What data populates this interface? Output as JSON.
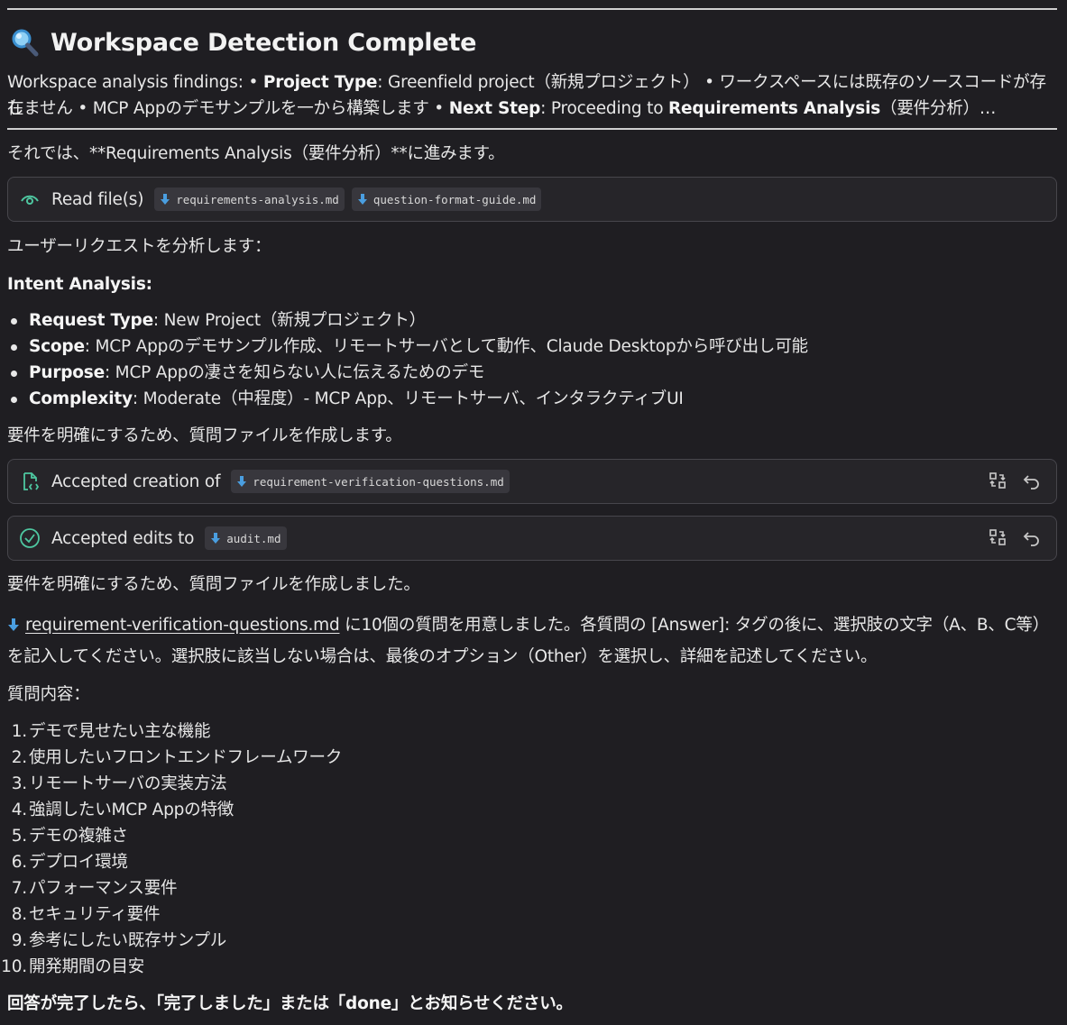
{
  "header": {
    "icon": "magnifier-icon",
    "title": "Workspace Detection Complete"
  },
  "findings": {
    "intro": "Workspace analysis findings: • ",
    "project_type_label": "Project Type",
    "project_type_value": ": Greenfield project（新規プロジェクト） • ワークスペースには既存のソースコードが存在",
    "line2_start": "しません • MCP Appのデモサンプルを一から構築します • ",
    "next_step_label": "Next Step",
    "next_step_mid": ": Proceeding to ",
    "next_step_target": "Requirements Analysis",
    "next_step_end": "（要件分析）…"
  },
  "proceed_text": "それでは、**Requirements Analysis（要件分析）**に進みます。",
  "read_card": {
    "label": "Read file(s)",
    "files": [
      "requirements-analysis.md",
      "question-format-guide.md"
    ]
  },
  "analyze_text": "ユーザーリクエストを分析します：",
  "intent": {
    "heading": "Intent Analysis:",
    "items": [
      {
        "label": "Request Type",
        "value": ": New Project（新規プロジェクト）"
      },
      {
        "label": "Scope",
        "value": ": MCP Appのデモサンプル作成、リモートサーバとして動作、Claude Desktopから呼び出し可能"
      },
      {
        "label": "Purpose",
        "value": ": MCP Appの凄さを知らない人に伝えるためのデモ"
      },
      {
        "label": "Complexity",
        "value": ": Moderate（中程度）- MCP App、リモートサーバ、インタラクティブUI"
      }
    ]
  },
  "create_text": "要件を明確にするため、質問ファイルを作成します。",
  "created_card": {
    "label": "Accepted creation of",
    "file": "requirement-verification-questions.md"
  },
  "edits_card": {
    "label": "Accepted edits to",
    "file": "audit.md"
  },
  "created_text": "要件を明確にするため、質問ファイルを作成しました。",
  "instructions": {
    "file_link": "requirement-verification-questions.md",
    "line1_rest": " に10個の質問を用意しました。各質問の [Answer]: タグの後に、選択肢の文字（A、B、C等）",
    "line2": "を記入してください。選択肢に該当しない場合は、最後のオプション（Other）を選択し、詳細を記述してください。"
  },
  "questions": {
    "heading": "質問内容：",
    "items": [
      "デモで見せたい主な機能",
      "使用したいフロントエンドフレームワーク",
      "リモートサーバの実装方法",
      "強調したいMCP Appの特徴",
      "デモの複雑さ",
      "デプロイ環境",
      "パフォーマンス要件",
      "セキュリティ要件",
      "参考にしたい既存サンプル",
      "開発期間の目安"
    ]
  },
  "closing": "回答が完了したら、「完了しました」または「done」とお知らせください。"
}
